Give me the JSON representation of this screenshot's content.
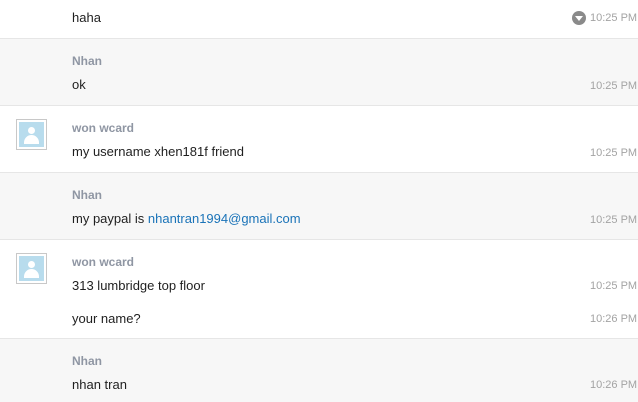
{
  "messages": [
    {
      "text": "haha",
      "time": "10:25 PM"
    },
    {
      "author": "Nhan",
      "text": "ok",
      "time": "10:25 PM"
    },
    {
      "author": "won wcard",
      "text": "my username xhen181f friend",
      "time": "10:25 PM"
    },
    {
      "author": "Nhan",
      "text_prefix": "my paypal is ",
      "link": "nhantran1994@gmail.com",
      "time": "10:25 PM"
    },
    {
      "author": "won wcard",
      "text": "313 lumbridge top floor",
      "time": "10:25 PM"
    },
    {
      "text": "your name?",
      "time": "10:26 PM"
    },
    {
      "author": "Nhan",
      "text": "nhan tran",
      "time": "10:26 PM"
    }
  ],
  "icons": {
    "avatar": "default-user-avatar-icon",
    "menu": "chevron-down-icon"
  }
}
